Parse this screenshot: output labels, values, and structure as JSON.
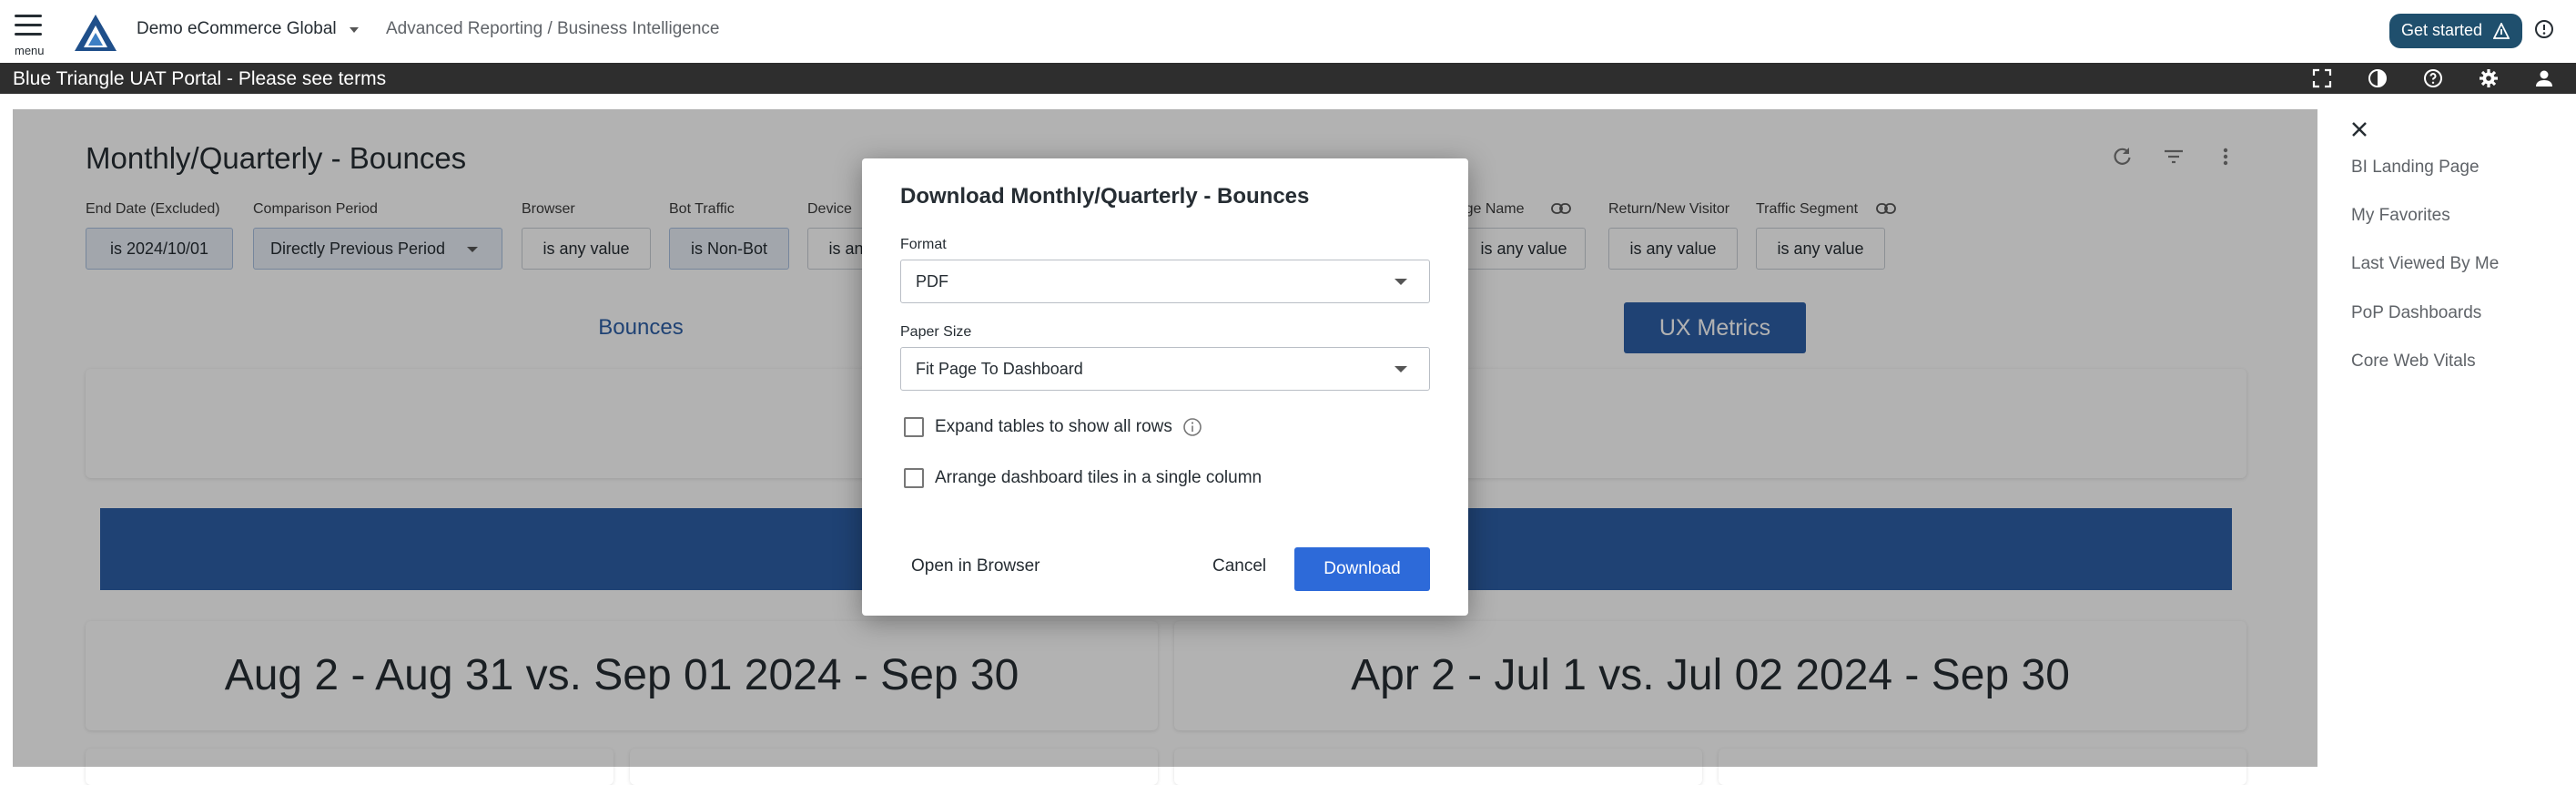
{
  "topbar": {
    "menu_caption": "menu",
    "org_name": "Demo eCommerce Global",
    "breadcrumb": "Advanced Reporting / Business Intelligence",
    "get_started_label": "Get started"
  },
  "banner": {
    "text": "Blue Triangle UAT Portal - Please see terms"
  },
  "dashboard": {
    "title": "Monthly/Quarterly - Bounces",
    "filters": [
      {
        "label": "End Date (Excluded)",
        "value": "is 2024/10/01"
      },
      {
        "label": "Comparison Period",
        "value": "Directly Previous Period"
      },
      {
        "label": "Browser",
        "value": "is any value"
      },
      {
        "label": "Bot Traffic",
        "value": "is Non-Bot"
      },
      {
        "label": "Device",
        "value": "is any value"
      },
      {
        "label": "Page Name",
        "value": "is any value"
      },
      {
        "label": "Return/New Visitor",
        "value": "is any value"
      },
      {
        "label": "Traffic Segment",
        "value": "is any value"
      }
    ],
    "tabs": {
      "bounces": "Bounces",
      "ux_metrics": "UX Metrics"
    },
    "periods": [
      "Aug 2 - Aug 31 vs. Sep 01 2024 - Sep 30",
      "Apr 2 - Jul 1 vs. Jul 02 2024 - Sep 30"
    ]
  },
  "side_panel": {
    "items": [
      "BI Landing Page",
      "My Favorites",
      "Last Viewed By Me",
      "PoP Dashboards",
      "Core Web Vitals"
    ]
  },
  "modal": {
    "title": "Download Monthly/Quarterly - Bounces",
    "format_label": "Format",
    "format_value": "PDF",
    "paper_label": "Paper Size",
    "paper_value": "Fit Page To Dashboard",
    "expand_label": "Expand tables to show all rows",
    "arrange_label": "Arrange dashboard tiles in a single column",
    "open_browser": "Open in Browser",
    "cancel": "Cancel",
    "download": "Download"
  },
  "colors": {
    "accent": "#2d6ad9",
    "brand_dark": "#1f4f6d",
    "banner": "#2e2e2e"
  }
}
